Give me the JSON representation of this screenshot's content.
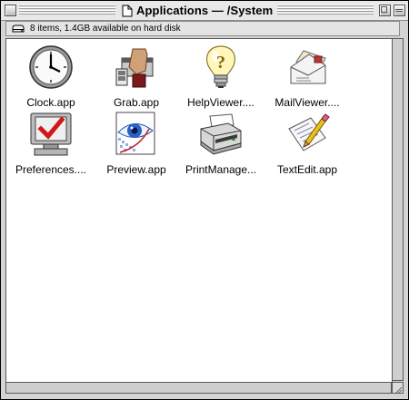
{
  "window": {
    "title": "Applications — /System"
  },
  "infobar": {
    "text": "8 items, 1.4GB available on hard disk",
    "icon": "hard-disk-icon"
  },
  "items": [
    {
      "label": "Clock.app",
      "icon": "clock-icon"
    },
    {
      "label": "Grab.app",
      "icon": "grab-icon"
    },
    {
      "label": "HelpViewer....",
      "icon": "lightbulb-icon"
    },
    {
      "label": "MailViewer....",
      "icon": "mail-envelope-icon"
    },
    {
      "label": "Preferences....",
      "icon": "preferences-monitor-icon"
    },
    {
      "label": "Preview.app",
      "icon": "eye-icon"
    },
    {
      "label": "PrintManage...",
      "icon": "printer-icon"
    },
    {
      "label": "TextEdit.app",
      "icon": "pen-document-icon"
    }
  ]
}
